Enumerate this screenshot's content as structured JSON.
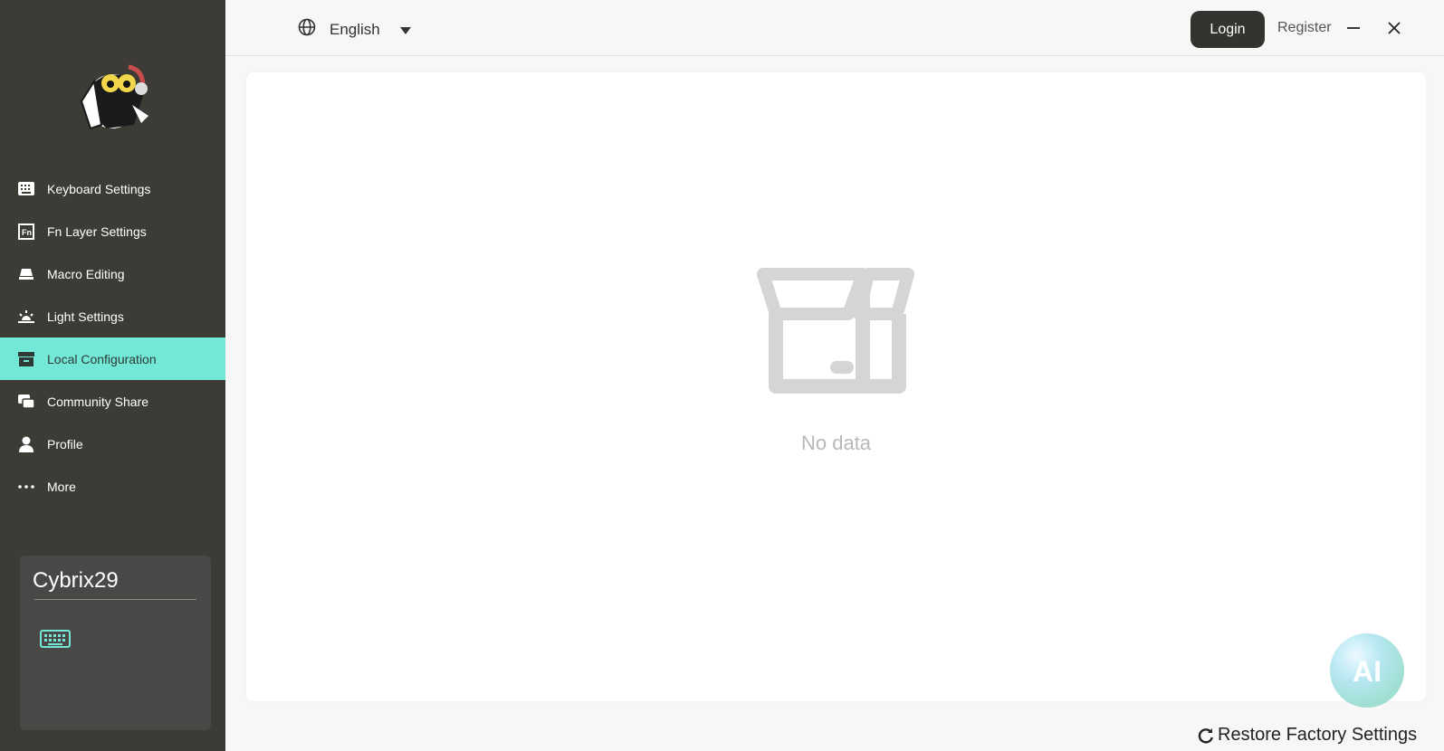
{
  "app": {
    "brand_colors": {
      "sidebar": "#3c3b35",
      "accent": "#74e8d6",
      "login": "#333330"
    }
  },
  "sidebar": {
    "logo": "mascot-logo",
    "items": [
      {
        "label": "Keyboard Settings",
        "icon": "keyboard-icon"
      },
      {
        "label": "Fn Layer Settings",
        "icon": "fn-icon"
      },
      {
        "label": "Macro Editing",
        "icon": "macro-icon"
      },
      {
        "label": "Light Settings",
        "icon": "light-icon"
      },
      {
        "label": "Local Configuration",
        "icon": "archive-icon",
        "active": true
      },
      {
        "label": "Community Share",
        "icon": "chat-icon"
      },
      {
        "label": "Profile",
        "icon": "user-icon"
      },
      {
        "label": "More",
        "icon": "more-icon"
      }
    ],
    "device": {
      "name": "Cybrix29",
      "icon": "keyboard-icon"
    }
  },
  "topbar": {
    "language": "English",
    "login_label": "Login",
    "register_label": "Register"
  },
  "main": {
    "empty_text": "No data"
  },
  "footer": {
    "restore_label": "Restore Factory Settings"
  }
}
